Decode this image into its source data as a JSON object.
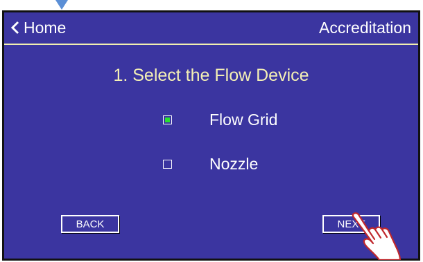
{
  "header": {
    "back_label": "Home",
    "title": "Accreditation"
  },
  "step": {
    "title": "1. Select the Flow Device"
  },
  "options": [
    {
      "label": "Flow Grid",
      "checked": true
    },
    {
      "label": "Nozzle",
      "checked": false
    }
  ],
  "buttons": {
    "back_label": "BACK",
    "next_label": "NEXT"
  },
  "icons": [
    "chevron-left-icon",
    "checkbox-icon",
    "pointing-hand-icon",
    "pointer-marker"
  ],
  "colors": {
    "background": "#3b35a0",
    "title_text": "#f4f0b5",
    "checked_fill": "#29e02f",
    "header_rule": "#f2efb0",
    "marker": "#5b8fd6"
  }
}
